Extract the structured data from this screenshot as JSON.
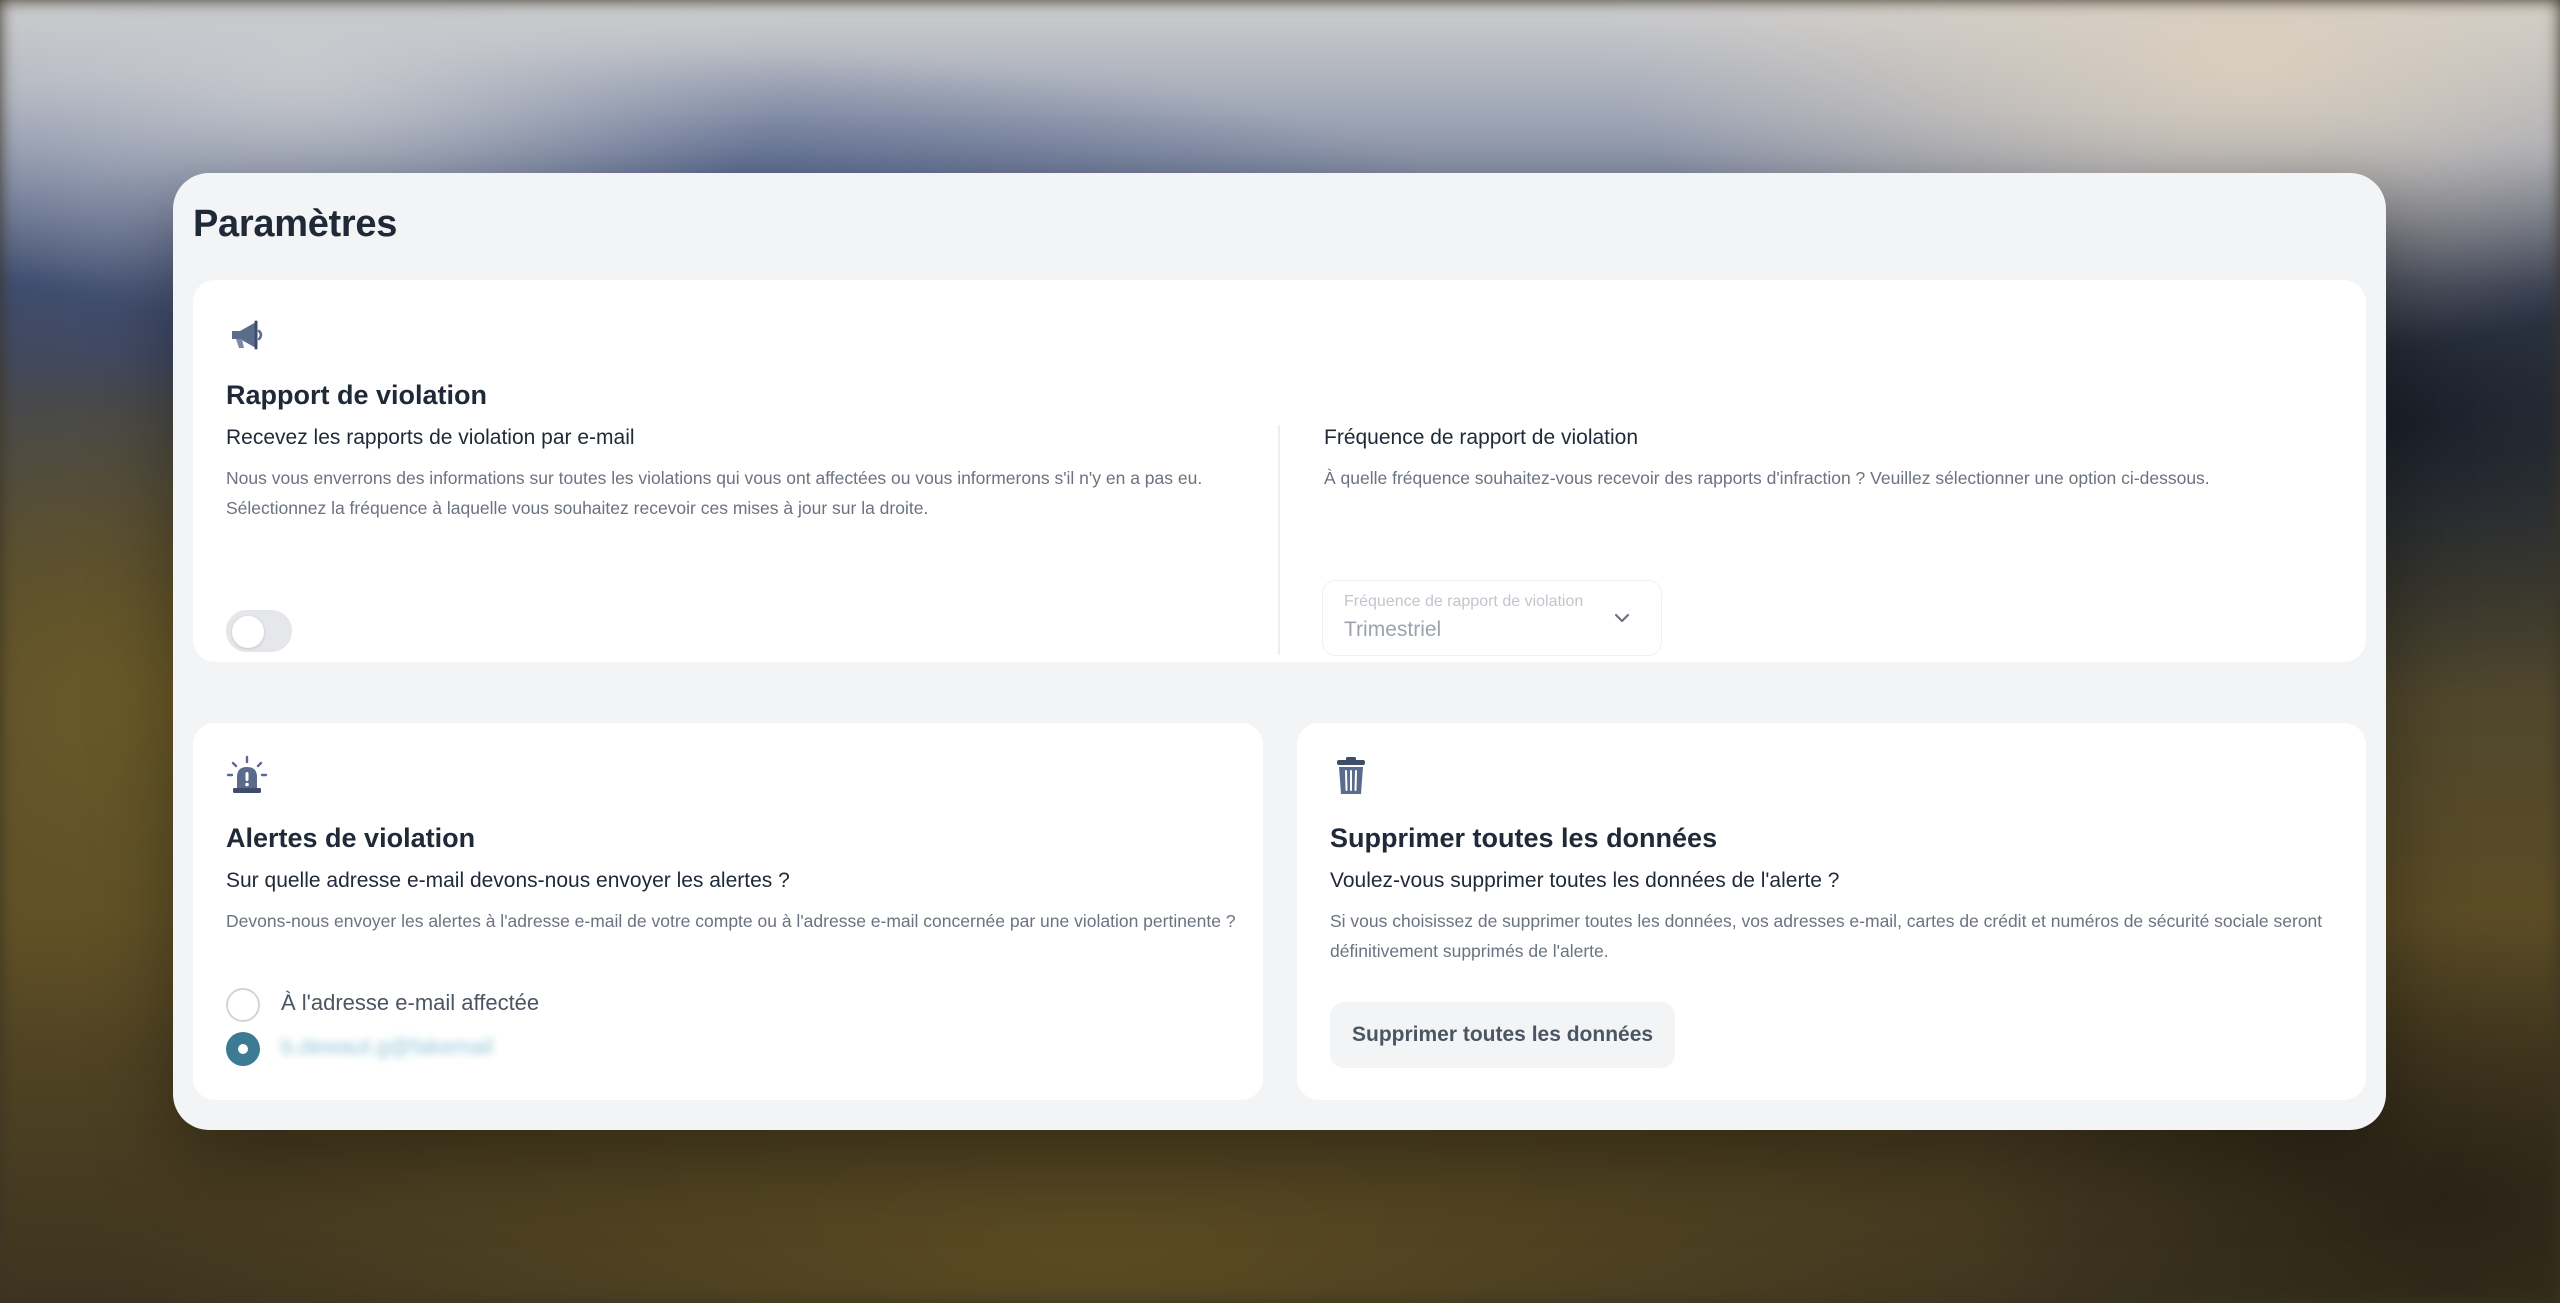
{
  "page": {
    "title": "Paramètres"
  },
  "report": {
    "icon": "megaphone-icon",
    "title": "Rapport de violation",
    "email_subtitle": "Recevez les rapports de violation par e-mail",
    "email_description": "Nous vous enverrons des informations sur toutes les violations qui vous ont affectées ou vous informerons s'il n'y en a pas eu. Sélectionnez la fréquence à laquelle vous souhaitez recevoir ces mises à jour sur la droite.",
    "email_toggle_on": false,
    "frequency_subtitle": "Fréquence de rapport de violation",
    "frequency_description": "À quelle fréquence souhaitez-vous recevoir des rapports d'infraction ? Veuillez sélectionner une option ci-dessous.",
    "frequency_select": {
      "label": "Fréquence de rapport de violation",
      "value": "Trimestriel"
    }
  },
  "alerts": {
    "icon": "siren-icon",
    "title": "Alertes de violation",
    "subtitle": "Sur quelle adresse e-mail devons-nous envoyer les alertes ?",
    "description": "Devons-nous envoyer les alertes à l'adresse e-mail de votre compte ou à l'adresse e-mail concernée par une violation pertinente ?",
    "options": [
      {
        "label": "À l'adresse e-mail affectée",
        "checked": false
      },
      {
        "label": "b.dewaut.g@fakemail",
        "checked": true
      }
    ]
  },
  "delete": {
    "icon": "trash-icon",
    "title": "Supprimer toutes les données",
    "subtitle": "Voulez-vous supprimer toutes les données de l'alerte ?",
    "description": "Si vous choisissez de supprimer toutes les données, vos adresses e-mail, cartes de crédit et numéros de sécurité sociale seront définitivement supprimés de l'alerte.",
    "button_label": "Supprimer toutes les données"
  },
  "colors": {
    "accent": "#3d7a93",
    "icon": "#5b6b8c",
    "window_bg": "#f3f4f6",
    "card_bg": "#ffffff"
  }
}
